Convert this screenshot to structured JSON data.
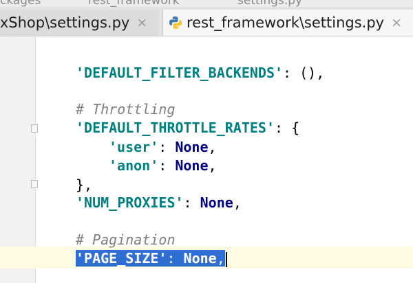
{
  "breadcrumb": {
    "left_text": "ckages",
    "middle_text": "rest_framework",
    "right_text": "settings.py"
  },
  "tabs": [
    {
      "label": "lxShop\\settings.py",
      "active": false
    },
    {
      "label": "rest_framework\\settings.py",
      "active": true
    }
  ],
  "code": {
    "line1": {
      "key": "'DEFAULT_FILTER_BACKENDS'",
      "rest": ": (),"
    },
    "comment_throttling": "# Throttling",
    "line_rates": {
      "key": "'DEFAULT_THROTTLE_RATES'",
      "rest": ": {"
    },
    "line_user": {
      "key": "'user'",
      "sep": ": ",
      "value": "None",
      "end": ","
    },
    "line_anon": {
      "key": "'anon'",
      "sep": ": ",
      "value": "None",
      "end": ","
    },
    "line_close": "},",
    "line_proxies": {
      "key": "'NUM_PROXIES'",
      "sep": ": ",
      "value": "None",
      "end": ","
    },
    "comment_pagination": "# Pagination",
    "line_page_size": {
      "key": "'PAGE_SIZE'",
      "sep": ": ",
      "value": "None",
      "end": ","
    }
  },
  "colors": {
    "string": "#008080",
    "keyword": "#000080",
    "comment": "#808080",
    "selection": "#2f6fd3",
    "current_line": "#fffbe2"
  },
  "icons": {
    "tab_close": "×",
    "file": "python-file-icon"
  }
}
